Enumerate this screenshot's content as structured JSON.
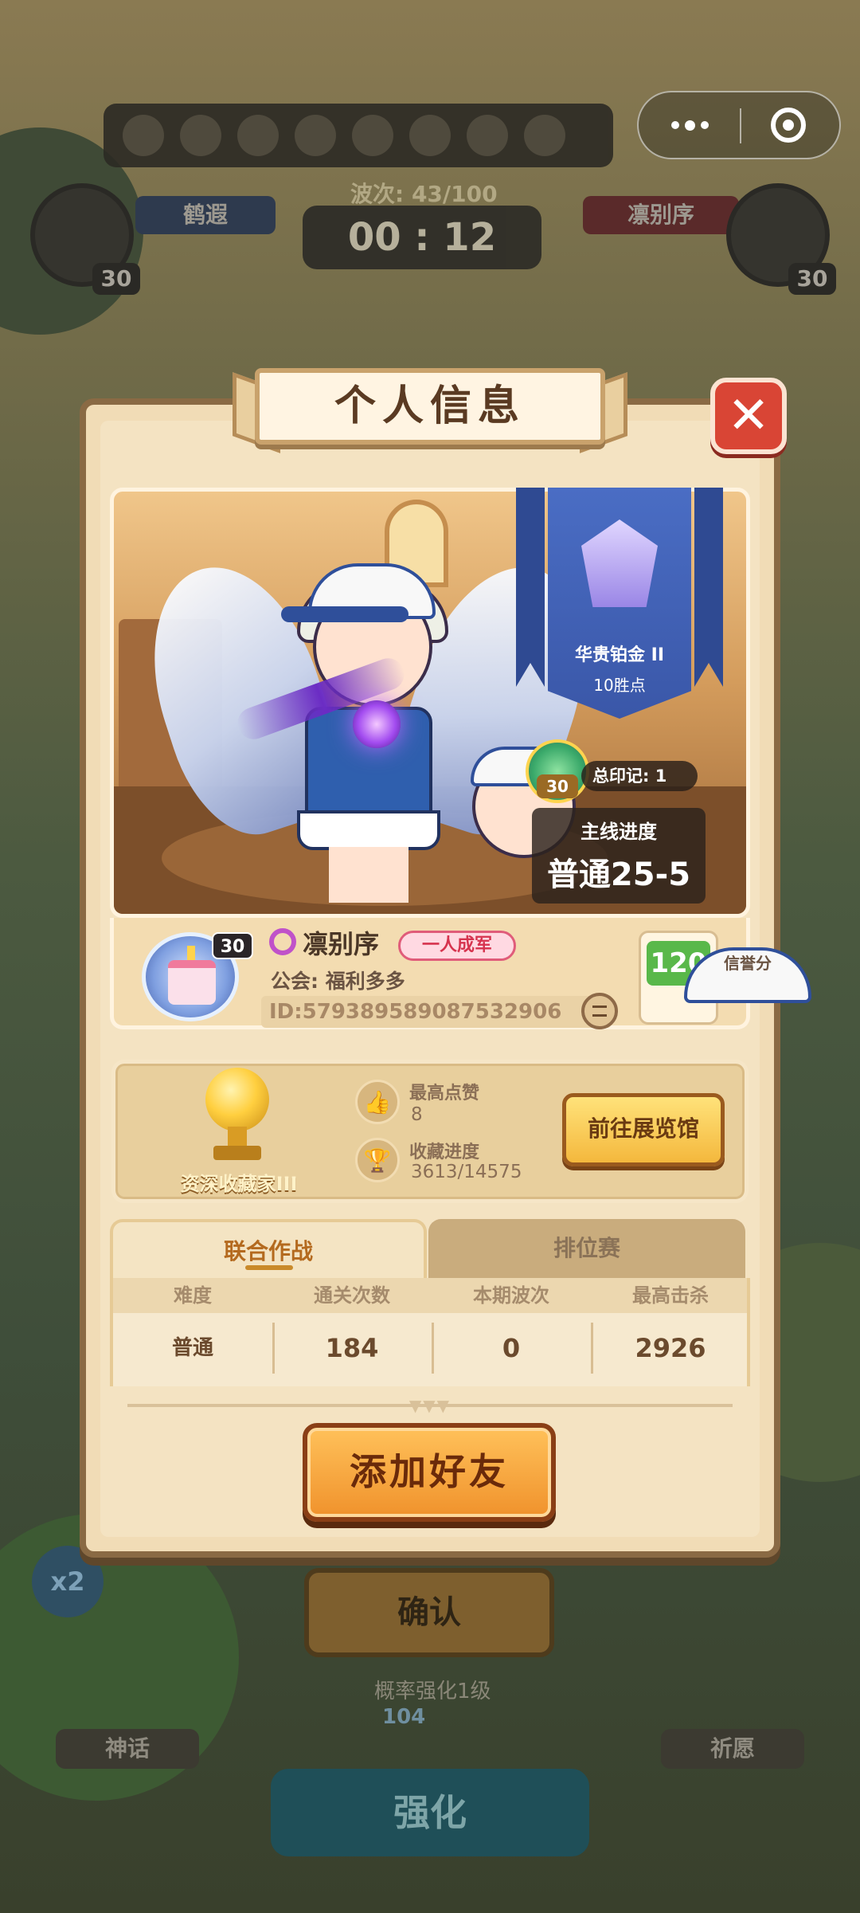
{
  "background": {
    "wave_label": "波次: 43/100",
    "timer": "00 : 12",
    "left_player": "鹤遐",
    "right_player": "凛别序",
    "left_level": "30",
    "right_level": "30",
    "confirm_label": "确认",
    "upgrade_hint": "概率强化1级",
    "upgrade_cost": "104",
    "strengthen_label": "强化",
    "left_side_label": "神话",
    "right_side_label": "祈愿",
    "speed_label": "x2"
  },
  "modal": {
    "title": "个人信息",
    "close_glyph": "✕",
    "rank": {
      "name": "华贵铂金 II",
      "points": "10胜点"
    },
    "marks": {
      "level": "30",
      "label": "总印记: 1"
    },
    "main_progress": {
      "label": "主线进度",
      "value": "普通25-5"
    },
    "profile": {
      "level": "30",
      "name": "凛别序",
      "title_tag": "一人成军",
      "guild": "公会: 福利多多",
      "id": "ID:579389589087532906",
      "credit_value": "120",
      "credit_label": "信誉分"
    },
    "collection": {
      "collector_title": "资深收藏家III",
      "likes_label": "最高点赞",
      "likes_value": "8",
      "progress_label": "收藏进度",
      "progress_value": "3613/14575",
      "gallery_button": "前往展览馆"
    },
    "tabs": [
      {
        "label": "联合作战",
        "active": true
      },
      {
        "label": "排位赛",
        "active": false
      }
    ],
    "table": {
      "headers": [
        "难度",
        "通关次数",
        "本期波次",
        "最高击杀"
      ],
      "row": [
        "普通",
        "184",
        "0",
        "2926"
      ]
    },
    "add_friend_button": "添加好友"
  },
  "colors": {
    "modal_bg": "#f1dcb6",
    "accent_orange": "#f0922c",
    "close_red": "#d94535",
    "rank_blue": "#4a6dc4"
  }
}
